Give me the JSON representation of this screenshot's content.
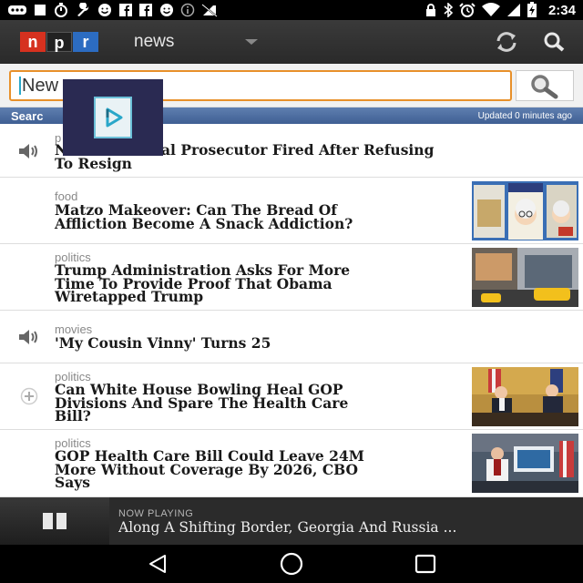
{
  "status_bar": {
    "time": "2:34",
    "left_icons": [
      "voicemail-icon",
      "square-icon",
      "timer-icon",
      "wrench-icon",
      "smiley-icon",
      "facebook-icon",
      "facebook-icon",
      "smiley-icon",
      "info-icon",
      "no-signal-icon"
    ],
    "right_icons": [
      "lock-icon",
      "bluetooth-icon",
      "alarm-icon",
      "wifi-icon",
      "signal-icon",
      "battery-icon"
    ]
  },
  "app_bar": {
    "logo": [
      "n",
      "p",
      "r"
    ],
    "section": "news",
    "icons": [
      "refresh-icon",
      "search-icon"
    ]
  },
  "search": {
    "value": "New",
    "button_icon": "magnifier-icon"
  },
  "results": {
    "label": "Searc",
    "updated": "Updated 0 minutes ago"
  },
  "stories": [
    {
      "category": "p",
      "title": "N          Federal Prosecutor Fired After Refusing To Resign",
      "title_lines": [
        "N          Federal Prosecutor Fired After Refusing",
        "To Resign"
      ],
      "icon": "speaker-icon",
      "thumb": null
    },
    {
      "category": "food",
      "title": "Matzo Makeover: Can The Bread Of Affliction Become A Snack Addiction?",
      "title_lines": [
        "Matzo Makeover: Can The Bread Of",
        "Affliction Become A Snack Addiction?"
      ],
      "icon": null,
      "thumb": "matzo-photo"
    },
    {
      "category": "politics",
      "title": "Trump Administration Asks For More Time To Provide Proof That Obama Wiretapped Trump",
      "title_lines": [
        "Trump Administration Asks For More",
        "Time To Provide Proof That Obama",
        "Wiretapped Trump"
      ],
      "icon": null,
      "thumb": "tower-photo"
    },
    {
      "category": "movies",
      "title": "'My Cousin Vinny' Turns 25",
      "title_lines": [
        "'My Cousin Vinny' Turns 25"
      ],
      "icon": "speaker-icon",
      "thumb": null
    },
    {
      "category": "politics",
      "title": "Can White House Bowling Heal GOP Divisions And Spare The Health Care Bill?",
      "title_lines": [
        "Can White House Bowling Heal GOP",
        "Divisions And Spare The Health Care",
        "Bill?"
      ],
      "icon": "plus-icon",
      "thumb": "whitehouse-photo"
    },
    {
      "category": "politics",
      "title": "GOP Health Care Bill Could Leave 24M More Without Coverage By 2026, CBO Says",
      "title_lines": [
        "GOP Health Care Bill Could Leave 24M",
        "More Without Coverage By 2026, CBO",
        "Says"
      ],
      "icon": null,
      "thumb": "podium-photo"
    }
  ],
  "now_playing": {
    "label": "NOW PLAYING",
    "title": "Along A Shifting Border, Georgia And Russia ..."
  },
  "nav": [
    "back-icon",
    "home-icon",
    "recents-icon"
  ],
  "colors": {
    "accent": "#e8902a",
    "npr_red": "#d6311f",
    "npr_blue": "#2c6cc1",
    "results_bar": "#4f6fa3"
  }
}
